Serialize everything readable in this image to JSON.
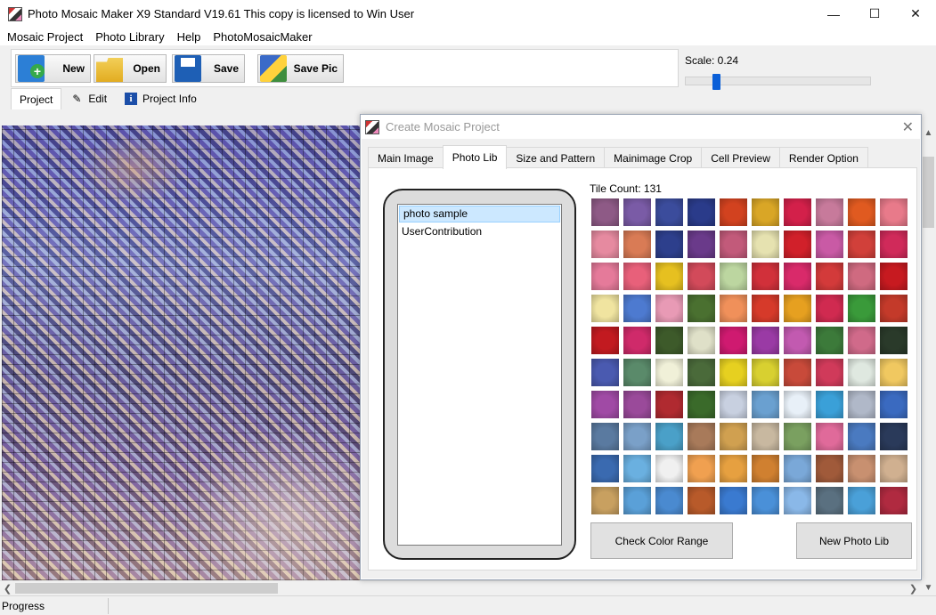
{
  "window": {
    "title": "Photo Mosaic Maker X9 Standard V19.61    This copy is licensed to Win User",
    "minimize_icon": "minimize-icon",
    "maximize_icon": "maximize-icon",
    "close_icon": "close-icon"
  },
  "menu": [
    "Mosaic Project",
    "Photo Library",
    "Help",
    "PhotoMosaicMaker"
  ],
  "toolbar": {
    "new_label": "New",
    "open_label": "Open",
    "save_label": "Save",
    "save_pic_label": "Save Pic"
  },
  "scale": {
    "label": "Scale: 0.24",
    "value": 0.24
  },
  "ribbon_tabs": {
    "project": "Project",
    "edit": "Edit",
    "project_info": "Project Info"
  },
  "status": {
    "progress_label": "Progress"
  },
  "dialog": {
    "title": "Create Mosaic Project",
    "tabs": [
      "Main Image",
      "Photo Lib",
      "Size and Pattern",
      "Mainimage Crop",
      "Cell Preview",
      "Render Option"
    ],
    "active_tab": "Photo Lib",
    "libraries": [
      "photo sample",
      "UserContribution"
    ],
    "selected_library": "photo sample",
    "tile_count": "Tile Count: 131",
    "check_color_range_label": "Check Color Range",
    "new_photo_lib_label": "New Photo Lib"
  },
  "colors": {
    "accent": "#0a5fd8",
    "selection": "#cce8ff",
    "tiles": [
      "#8e5a86",
      "#7a5ba6",
      "#3b4c9c",
      "#2a3b8a",
      "#d2421f",
      "#d9a626",
      "#d3204a",
      "#c77a9b",
      "#e05a20",
      "#e87a8a",
      "#e68aa0",
      "#d97b55",
      "#2d3f8c",
      "#6a3a8a",
      "#c25a7a",
      "#e6e2b0",
      "#d1202a",
      "#c95aa5",
      "#d1403a",
      "#d02a5a",
      "#e57a9a",
      "#e8607a",
      "#e6c020",
      "#d24a5a",
      "#bcd6a0",
      "#d1303a",
      "#d92a6a",
      "#d33a3a",
      "#cf6a80",
      "#c71a20",
      "#f0e4a0",
      "#4d7ad0",
      "#e89ab5",
      "#4a7030",
      "#f0905a",
      "#d63a2a",
      "#e6a020",
      "#d02a50",
      "#3a9a3a",
      "#c43a2a",
      "#c21a20",
      "#cf2a6a",
      "#3d5a2a",
      "#dfe0c8",
      "#cf1a70",
      "#9a3aa5",
      "#c25ab0",
      "#3c7a3a",
      "#d06a8a",
      "#2a3a2a",
      "#4a5ab0",
      "#5a8a6a",
      "#f0f0d8",
      "#4a6a3a",
      "#e6d020",
      "#d8d030",
      "#c84a3a",
      "#d03a5a",
      "#dfe8e0",
      "#f0c860",
      "#a04aa5",
      "#9a4a9a",
      "#b02a30",
      "#3a6a2a",
      "#c8d0e0",
      "#6aa0d0",
      "#e8f0f8",
      "#3aa0d8",
      "#b0b8c8",
      "#3a6ac0",
      "#5a7aa0",
      "#7aa0c8",
      "#4aa0c8",
      "#a87a5a",
      "#d0a050",
      "#c8b8a0",
      "#7aa060",
      "#e06a9a",
      "#4a7ac0",
      "#2a3a5a",
      "#3a6ab0",
      "#6ab0e0",
      "#f0f0f0",
      "#f0a050",
      "#e6a040",
      "#d08030",
      "#7aa8d8",
      "#a05a3a",
      "#c89070",
      "#d0b090",
      "#c8a060",
      "#5aa0d8",
      "#4a8ad0",
      "#b85a2a",
      "#3a7ad0",
      "#4a90d8",
      "#8ab8e8",
      "#5a7080",
      "#4aa0d8",
      "#b02a40"
    ]
  }
}
